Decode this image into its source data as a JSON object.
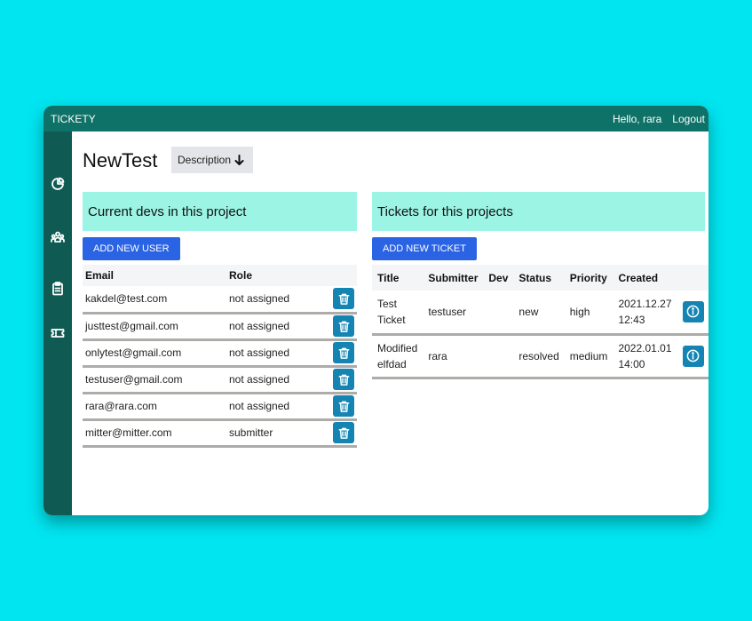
{
  "app": {
    "name": "TICKETY",
    "greeting": "Hello, rara",
    "logout_label": "Logout"
  },
  "colors": {
    "page_bg": "#00e5f0",
    "topbar": "#0e7268",
    "sidebar": "#0f5a53",
    "panel_header": "#9cf4e4",
    "primary_button": "#2a63e3",
    "icon_button": "#1485b3"
  },
  "sidebar": {
    "items": [
      {
        "icon": "pie-chart-icon"
      },
      {
        "icon": "users-icon"
      },
      {
        "icon": "clipboard-icon"
      },
      {
        "icon": "ticket-icon"
      }
    ]
  },
  "project": {
    "title": "NewTest",
    "description_label": "Description"
  },
  "devs_panel": {
    "header": "Current devs in this project",
    "add_label": "ADD NEW USER",
    "columns": [
      "Email",
      "Role"
    ],
    "rows": [
      {
        "email": "kakdel@test.com",
        "role": "not assigned"
      },
      {
        "email": "justtest@gmail.com",
        "role": "not assigned"
      },
      {
        "email": "onlytest@gmail.com",
        "role": "not assigned"
      },
      {
        "email": "testuser@gmail.com",
        "role": "not assigned"
      },
      {
        "email": "rara@rara.com",
        "role": "not assigned"
      },
      {
        "email": "mitter@mitter.com",
        "role": "submitter"
      }
    ]
  },
  "tickets_panel": {
    "header": "Tickets for this projects",
    "add_label": "ADD NEW TICKET",
    "columns": [
      "Title",
      "Submitter",
      "Dev",
      "Status",
      "Priority",
      "Created"
    ],
    "rows": [
      {
        "title": "Test Ticket",
        "submitter": "testuser",
        "dev": "",
        "status": "new",
        "priority": "high",
        "created": "2021.12.27 12:43"
      },
      {
        "title": "Modified elfdad",
        "submitter": "rara",
        "dev": "",
        "status": "resolved",
        "priority": "medium",
        "created": "2022.01.01 14:00"
      }
    ]
  }
}
